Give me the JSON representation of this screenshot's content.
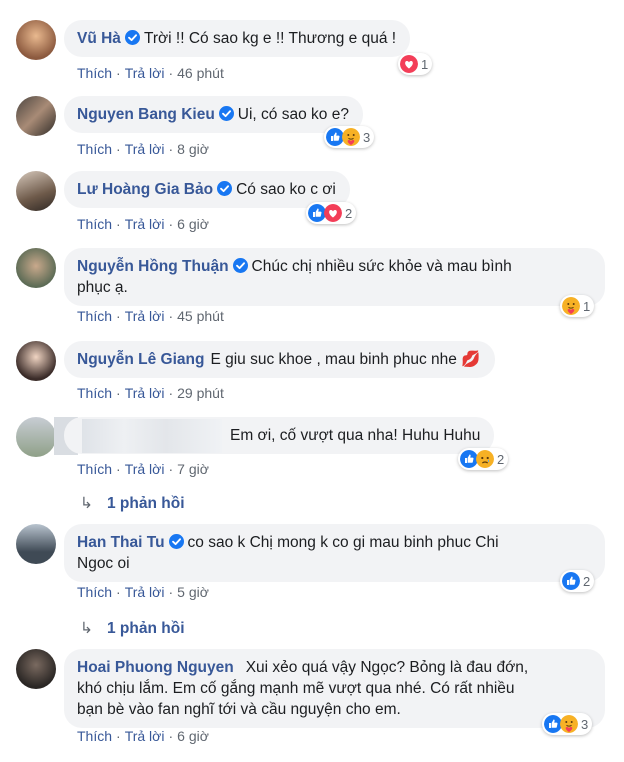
{
  "actions": {
    "like": "Thích",
    "reply": "Trả lời",
    "sep": "·"
  },
  "colors": {
    "name": "#385898",
    "like_blue": "#1877f2",
    "love_red": "#f33e58",
    "haha_yellow": "#f7b125"
  },
  "comments": [
    {
      "name": "Vũ Hà",
      "text": "Trời !! Có sao kg e !! Thương e quá !",
      "time": "46 phút",
      "reactions": [
        "love"
      ],
      "count": "1"
    },
    {
      "name": "Nguyen Bang Kieu",
      "text": "Ui, có sao ko e?",
      "time": "8 giờ",
      "reactions": [
        "like",
        "care"
      ],
      "count": "3"
    },
    {
      "name": "Lư Hoàng Gia Bảo",
      "text": "Có sao ko c ơi",
      "time": "6 giờ",
      "reactions": [
        "like",
        "love"
      ],
      "count": "2"
    },
    {
      "name": "Nguyễn Hồng Thuận",
      "text": "Chúc chị nhiều sức khỏe và mau bình",
      "text2": "phục ạ.",
      "time": "45 phút",
      "reactions": [
        "care"
      ],
      "count": "1"
    },
    {
      "name": "Nguyễn Lê Giang",
      "text": "E giu suc khoe , mau binh phuc nhe 💋",
      "time": "29 phút"
    },
    {
      "name": "",
      "text": "Em ơi, cố vượt qua nha! Huhu Huhu",
      "time": "7 giờ",
      "reactions": [
        "like",
        "sad"
      ],
      "count": "2"
    },
    {
      "name": "Han Thai Tu",
      "text": "co sao k Chị mong k co gi mau binh phuc Chi",
      "text2": "Ngoc oi",
      "time": "5 giờ",
      "reactions": [
        "like"
      ],
      "count": "2"
    },
    {
      "name": "Hoai Phuong Nguyen",
      "text": "Xui xẻo quá vậy Ngọc? Bỏng là đau đớn,",
      "text2": "khó chịu lắm. Em cố gắng mạnh mẽ vượt qua nhé. Có rất nhiều",
      "text3": "bạn bè vào fan nghĩ tới và cầu nguyện cho em.",
      "time": "6 giờ",
      "reactions": [
        "like",
        "care"
      ],
      "count": "3"
    }
  ],
  "replies": [
    {
      "arrow": "↳",
      "label": "1 phản hồi"
    },
    {
      "arrow": "↳",
      "label": "1 phản hồi"
    }
  ]
}
